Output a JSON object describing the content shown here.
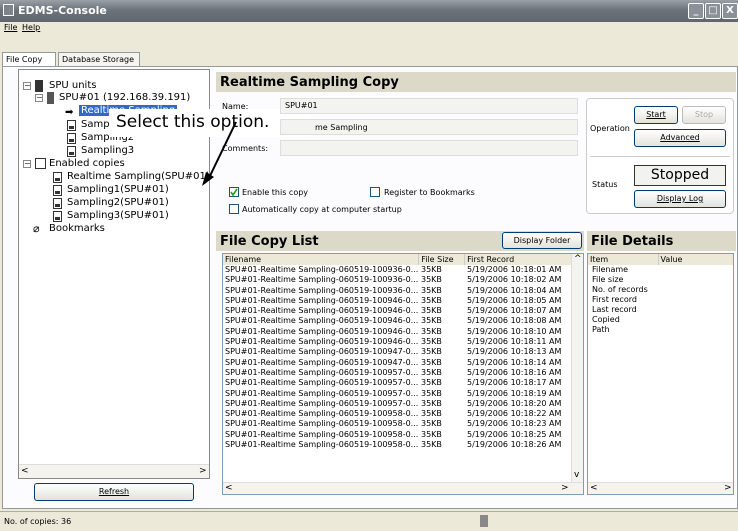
{
  "window": {
    "title": "EDMS-Console"
  },
  "menu": [
    "File",
    "Help"
  ],
  "tabs": [
    "File Copy",
    "Database Storage"
  ],
  "tree": {
    "root": "SPU units",
    "unit": "SPU#01 (192.168.39.191)",
    "items": [
      "Realtime Sampling",
      "Sampling1",
      "Sampling2",
      "Sampling3"
    ],
    "copies_label": "Enabled copies",
    "copies": [
      "Realtime Sampling(SPU#01)",
      "Sampling1(SPU#01)",
      "Sampling2(SPU#01)",
      "Sampling3(SPU#01)"
    ],
    "bookmarks": "Bookmarks"
  },
  "callout": "Select this option.",
  "refresh_label": "Refresh",
  "section_title": "Realtime Sampling Copy",
  "form": {
    "name_label": "Name:",
    "name_value": "SPU#01",
    "source_value": "me Sampling",
    "comments_label": "Comments:",
    "enable_label": "Enable this copy",
    "bookmarks_label": "Register to Bookmarks",
    "auto_label": "Automatically copy at computer startup"
  },
  "operation": {
    "label": "Operation",
    "start": "Start",
    "stop": "Stop",
    "advanced": "Advanced"
  },
  "status": {
    "label": "Status",
    "value": "Stopped",
    "display_log": "Display Log"
  },
  "file_list": {
    "title": "File Copy List",
    "display_folder": "Display Folder",
    "headers": [
      "Filename",
      "File Size",
      "First Record"
    ],
    "rows": [
      [
        "SPU#01-Realtime Sampling-060519-100936-0...",
        "35KB",
        "5/19/2006 10:18:01 AM"
      ],
      [
        "SPU#01-Realtime Sampling-060519-100936-0...",
        "35KB",
        "5/19/2006 10:18:02 AM"
      ],
      [
        "SPU#01-Realtime Sampling-060519-100936-0...",
        "35KB",
        "5/19/2006 10:18:04 AM"
      ],
      [
        "SPU#01-Realtime Sampling-060519-100946-0...",
        "35KB",
        "5/19/2006 10:18:05 AM"
      ],
      [
        "SPU#01-Realtime Sampling-060519-100946-0...",
        "35KB",
        "5/19/2006 10:18:07 AM"
      ],
      [
        "SPU#01-Realtime Sampling-060519-100946-0...",
        "35KB",
        "5/19/2006 10:18:08 AM"
      ],
      [
        "SPU#01-Realtime Sampling-060519-100946-0...",
        "35KB",
        "5/19/2006 10:18:10 AM"
      ],
      [
        "SPU#01-Realtime Sampling-060519-100946-0...",
        "35KB",
        "5/19/2006 10:18:11 AM"
      ],
      [
        "SPU#01-Realtime Sampling-060519-100947-0...",
        "35KB",
        "5/19/2006 10:18:13 AM"
      ],
      [
        "SPU#01-Realtime Sampling-060519-100947-0...",
        "35KB",
        "5/19/2006 10:18:14 AM"
      ],
      [
        "SPU#01-Realtime Sampling-060519-100957-0...",
        "35KB",
        "5/19/2006 10:18:16 AM"
      ],
      [
        "SPU#01-Realtime Sampling-060519-100957-0...",
        "35KB",
        "5/19/2006 10:18:17 AM"
      ],
      [
        "SPU#01-Realtime Sampling-060519-100957-0...",
        "35KB",
        "5/19/2006 10:18:19 AM"
      ],
      [
        "SPU#01-Realtime Sampling-060519-100957-0...",
        "35KB",
        "5/19/2006 10:18:20 AM"
      ],
      [
        "SPU#01-Realtime Sampling-060519-100958-0...",
        "35KB",
        "5/19/2006 10:18:22 AM"
      ],
      [
        "SPU#01-Realtime Sampling-060519-100958-0...",
        "35KB",
        "5/19/2006 10:18:23 AM"
      ],
      [
        "SPU#01-Realtime Sampling-060519-100958-0...",
        "35KB",
        "5/19/2006 10:18:25 AM"
      ],
      [
        "SPU#01-Realtime Sampling-060519-100958-0...",
        "35KB",
        "5/19/2006 10:18:26 AM"
      ]
    ]
  },
  "file_details": {
    "title": "File Details",
    "headers": [
      "Item",
      "Value"
    ],
    "items": [
      "Filename",
      "File size",
      "No. of records",
      "First record",
      "Last record",
      "Copied",
      "Path"
    ]
  },
  "statusbar": {
    "copies": "No. of copies: 36"
  }
}
